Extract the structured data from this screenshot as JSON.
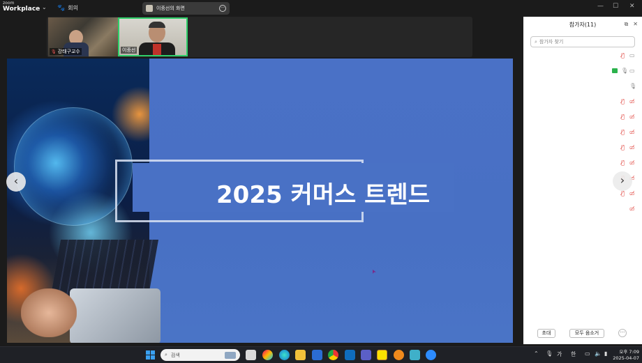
{
  "titlebar": {
    "brand_small": "zoom",
    "brand_big": "Workplace",
    "meeting_label": "회의",
    "share_label": "이종선의 화면",
    "min_label": "—",
    "max_label": "☐",
    "close_label": "✕"
  },
  "videos": [
    {
      "name": "강태구교수"
    },
    {
      "name": "이종선"
    }
  ],
  "slide": {
    "title": "2025 커머스 트렌드"
  },
  "panel": {
    "title": "참가자(11)",
    "search_placeholder": "참가자 찾기",
    "invite_label": "초대",
    "mute_all_label": "모두 음소거",
    "more_label": "···"
  },
  "taskbar": {
    "search_label": "검색",
    "lang1": "가",
    "lang2": "한",
    "time": "오후 7:09",
    "date": "2025-04-07"
  },
  "colors": {
    "slide_bg": "#4870c4",
    "active_border": "#2fd06a",
    "muted_red": "#e0443e"
  }
}
